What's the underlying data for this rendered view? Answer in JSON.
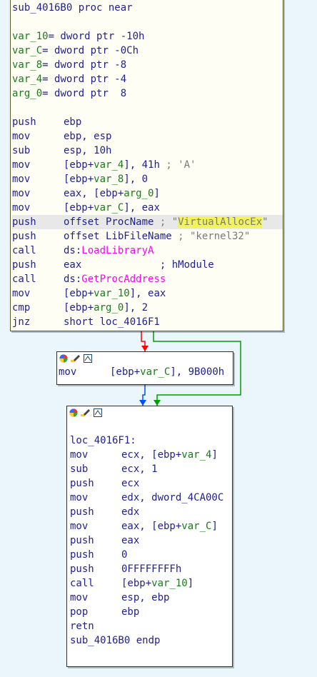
{
  "colors": {
    "background": "#eaf6fb",
    "text": "#1f1f8f",
    "var_name": "#1b7a1b",
    "comment": "#7a7a7a",
    "api": "#ff00ff",
    "highlight_yellow": "#f2f25e",
    "edge_red": "#ff0000",
    "edge_green": "#00a000",
    "edge_blue": "#0050ff"
  },
  "node1": {
    "proc_header": "sub_4016B0 proc near",
    "vars": [
      {
        "name": "var_10",
        "def": "= dword ptr -10h"
      },
      {
        "name": "var_C",
        "def": "= dword ptr -0Ch"
      },
      {
        "name": "var_8",
        "def": "= dword ptr -8"
      },
      {
        "name": "var_4",
        "def": "= dword ptr -4"
      },
      {
        "name": "arg_0",
        "def": "= dword ptr  8"
      }
    ],
    "instr": [
      {
        "m": "push",
        "op": "ebp"
      },
      {
        "m": "mov",
        "op": "ebp, esp"
      },
      {
        "m": "sub",
        "op": "esp, 10h"
      },
      {
        "m": "mov",
        "pre": "[ebp+",
        "var": "var_4",
        "post": "], 41h",
        "cmt": " ; 'A'"
      },
      {
        "m": "mov",
        "pre": "[ebp+",
        "var": "var_8",
        "post": "], 0"
      },
      {
        "m": "mov",
        "pre": "eax, [ebp+",
        "var": "arg_0",
        "post": "]"
      },
      {
        "m": "mov",
        "pre": "[ebp+",
        "var": "var_C",
        "post": "], eax"
      },
      {
        "m": "push",
        "pre": "offset ProcName",
        "cmt": " ; \"",
        "yh": "VirtualAllocEx",
        "cmt2": "\""
      },
      {
        "m": "push",
        "pre": "offset LibFileName",
        "cmt": " ; \"kernel32\""
      },
      {
        "m": "call",
        "pre": "ds:",
        "api": "LoadLibraryA"
      },
      {
        "m": "push",
        "pre": "eax",
        "pad": "             ",
        "post": "; hModule"
      },
      {
        "m": "call",
        "pre": "ds:",
        "api": "GetProcAddress"
      },
      {
        "m": "mov",
        "pre": "[ebp+",
        "var": "var_10",
        "post": "], eax"
      },
      {
        "m": "cmp",
        "pre": "[ebp+",
        "var": "arg_0",
        "post": "], 2"
      },
      {
        "m": "jnz",
        "op": "short loc_4016F1"
      }
    ]
  },
  "node2": {
    "instr": {
      "m": "mov",
      "pre": "[ebp+",
      "var": "var_C",
      "post": "], 9B000h"
    }
  },
  "node3": {
    "label": "loc_4016F1:",
    "instr": [
      {
        "m": "mov",
        "pre": "ecx, [ebp+",
        "var": "var_4",
        "post": "]"
      },
      {
        "m": "sub",
        "op": "ecx, 1"
      },
      {
        "m": "push",
        "op": "ecx"
      },
      {
        "m": "mov",
        "op": "edx, dword_4CA00C"
      },
      {
        "m": "push",
        "op": "edx"
      },
      {
        "m": "mov",
        "pre": "eax, [ebp+",
        "var": "var_C",
        "post": "]"
      },
      {
        "m": "push",
        "op": "eax"
      },
      {
        "m": "push",
        "op": "0"
      },
      {
        "m": "push",
        "op": "0FFFFFFFFh"
      },
      {
        "m": "call",
        "pre": "[ebp+",
        "var": "var_10",
        "post": "]"
      },
      {
        "m": "mov",
        "op": "esp, ebp"
      },
      {
        "m": "pop",
        "op": "ebp"
      },
      {
        "m": "retn",
        "op": ""
      }
    ],
    "endp": "sub_4016B0 endp"
  }
}
